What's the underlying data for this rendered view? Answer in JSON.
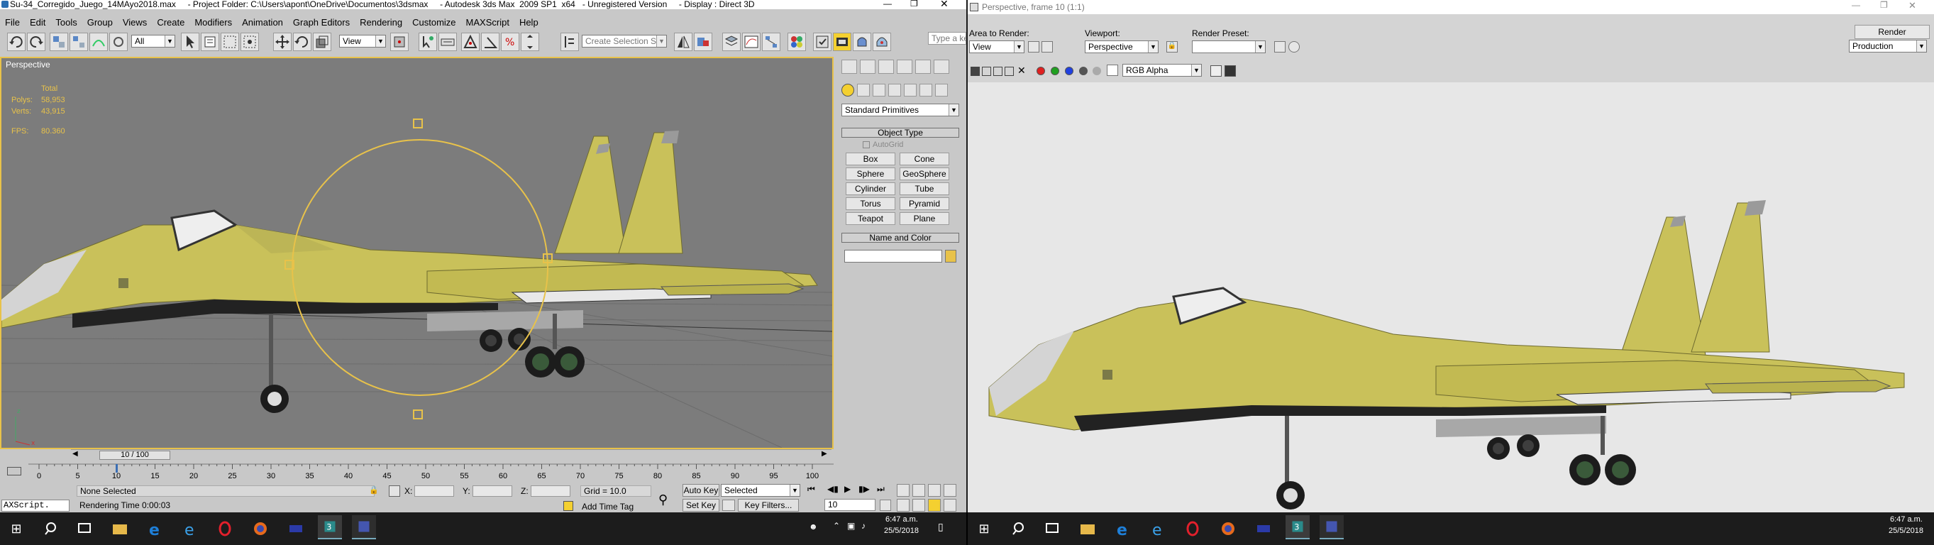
{
  "max_window": {
    "title": "Su-34_Corregido_Juego_14MAyo2018.max     - Project Folder: C:\\Users\\apont\\OneDrive\\Documentos\\3dsmax     - Autodesk 3ds Max  2009 SP1  x64   - Unregistered Version     - Display : Direct 3D",
    "menu": [
      "File",
      "Edit",
      "Tools",
      "Group",
      "Views",
      "Create",
      "Modifiers",
      "Animation",
      "Graph Editors",
      "Rendering",
      "Customize",
      "MAXScript",
      "Help"
    ],
    "toolbar": {
      "filter_value": "All",
      "ref_coord": "View",
      "selection_set_placeholder": "Create Selection Set",
      "search_placeholder": "Type a ke"
    },
    "viewport": {
      "label": "Perspective",
      "stats": {
        "header": "Total",
        "polys_label": "Polys:",
        "polys_value": "58,953",
        "verts_label": "Verts:",
        "verts_value": "43,915",
        "fps_label": "FPS:",
        "fps_value": "80.360"
      }
    },
    "command_panel": {
      "category": "Standard Primitives",
      "object_type_title": "Object Type",
      "autogrid": "AutoGrid",
      "buttons": [
        "Box",
        "Cone",
        "Sphere",
        "GeoSphere",
        "Cylinder",
        "Tube",
        "Torus",
        "Pyramid",
        "Teapot",
        "Plane"
      ],
      "name_color_title": "Name and Color",
      "object_color": "#e8c24a"
    },
    "time_slider": {
      "label": "10 / 100",
      "current_frame": 10,
      "total_frames": 100
    },
    "track_ticks": [
      "0",
      "5",
      "10",
      "15",
      "20",
      "25",
      "30",
      "35",
      "40",
      "45",
      "50",
      "55",
      "60",
      "65",
      "70",
      "75",
      "80",
      "85",
      "90",
      "95",
      "100"
    ],
    "status": {
      "maxscript": "AXScript.",
      "selection": "None Selected",
      "x_label": "X:",
      "y_label": "Y:",
      "z_label": "Z:",
      "grid": "Grid = 10.0",
      "rendering_time": "Rendering Time  0:00:03",
      "add_time_tag": "Add Time Tag"
    },
    "anim": {
      "auto_key": "Auto Key",
      "selected": "Selected",
      "set_key": "Set Key",
      "key_filters": "Key Filters...",
      "frame": "10"
    }
  },
  "render_window": {
    "title": "Perspective, frame 10 (1:1)",
    "area_label": "Area to Render:",
    "area_value": "View",
    "viewport_label": "Viewport:",
    "viewport_value": "Perspective",
    "preset_label": "Render Preset:",
    "preset_value": "",
    "render_button": "Render",
    "mode_value": "Production",
    "channel_value": "RGB Alpha"
  },
  "taskbar": {
    "left": {
      "time": "6:47 a.m.",
      "date": "25/5/2018"
    },
    "right": {
      "time": "6:47 a.m.",
      "date": "25/5/2018"
    }
  },
  "colors": {
    "jet_body": "#c9c15a",
    "viewport_bg": "#7c7c7c",
    "render_bg": "#e7e7e7",
    "selection_yellow": "#e8c24a",
    "taskbar": "#1c1c1c"
  }
}
